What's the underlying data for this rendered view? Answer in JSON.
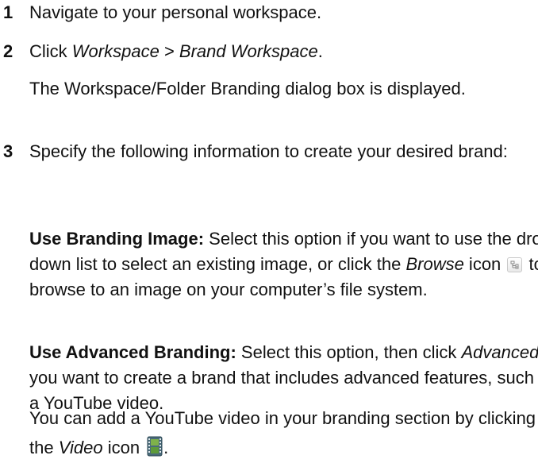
{
  "steps": [
    {
      "number": "1",
      "text": "Navigate to your personal workspace."
    },
    {
      "number": "2",
      "click": "Click ",
      "workspace": "Workspace",
      "separator": " > ",
      "brand_workspace": "Brand Workspace",
      "period": ".",
      "note": "The Workspace/Folder Branding dialog box is displayed."
    },
    {
      "number": "3",
      "text": "Specify the following information to create your desired brand:",
      "option1": {
        "label": "Use Branding Image:",
        "text_before": " Select this option if you want to use the drop-down list to select an existing image, or click the ",
        "browse": "Browse",
        "icon_word": " icon ",
        "text_after": " to browse to an image on your computer’s file system."
      },
      "option2": {
        "label": "Use Advanced Branding:",
        "text_before": " Select this option, then click ",
        "advanced": "Advanced",
        "text_after": " if you want to create a brand that includes advanced features, such as a YouTube video."
      },
      "video_note": {
        "text_before": "You can add a YouTube video in your branding section by clicking the ",
        "video": "Video",
        "icon_word": " icon ",
        "period": "."
      }
    }
  ],
  "icons": {
    "browse": "browse-icon",
    "video": "video-icon"
  }
}
